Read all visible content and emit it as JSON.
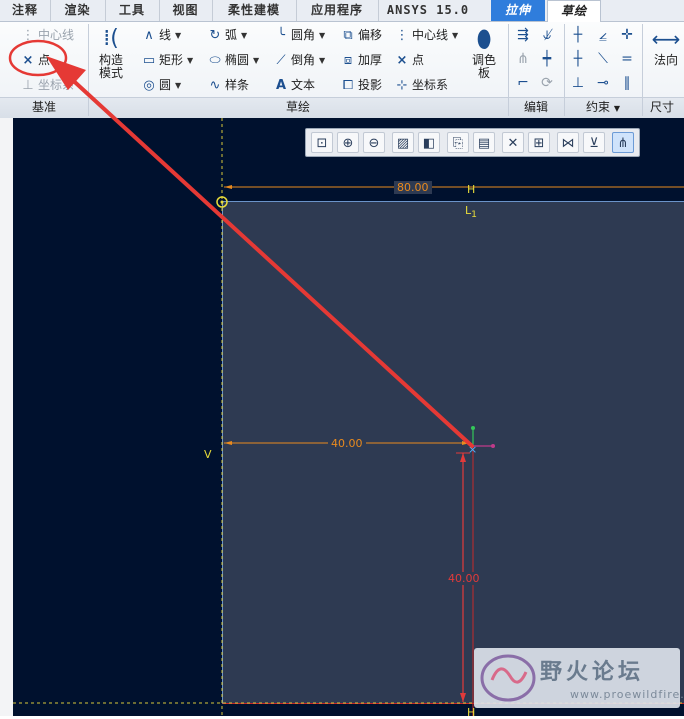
{
  "tabs": [
    {
      "label": "注释"
    },
    {
      "label": "渲染"
    },
    {
      "label": "工具"
    },
    {
      "label": "视图"
    },
    {
      "label": "柔性建模"
    },
    {
      "label": "应用程序"
    },
    {
      "label": "ANSYS 15.0"
    },
    {
      "label": "拉伸"
    },
    {
      "label": "草绘"
    }
  ],
  "ribbon": {
    "datum": {
      "group_label": "基准",
      "centerline": "中心线",
      "point": "点",
      "coord_sys": "坐标系"
    },
    "construction_mode": {
      "line1": "构造",
      "line2": "模式"
    },
    "sketch": {
      "group_label": "草绘",
      "line": "线",
      "rectangle": "矩形",
      "circle": "圆",
      "arc": "弧",
      "ellipse": "椭圆",
      "spline": "样条",
      "fillet": "圆角",
      "chamfer": "倒角",
      "text": "文本",
      "offset": "偏移",
      "thicken": "加厚",
      "project": "投影",
      "centerline": "中心线",
      "point": "点",
      "coord_sys": "坐标系"
    },
    "palette": {
      "line1": "调色",
      "line2": "板"
    },
    "edit": {
      "group_label": "编辑"
    },
    "constrain": {
      "group_label": "约束"
    },
    "dimension": {
      "normal": "法向",
      "group_label": "尺寸"
    }
  },
  "canvas": {
    "dim_top": "80.00",
    "dim_horizontal": "40.00",
    "dim_vertical": "40.00",
    "label_h_top": "H",
    "label_l1": "L",
    "label_l1_sub": "1",
    "label_v": "V",
    "label_h_bottom": "H"
  },
  "watermark": {
    "title": "野火论坛",
    "url": "www.proewildfire.cn"
  },
  "colors": {
    "canvas_bg": "#00112e",
    "sketch_fill": "#2e3a52",
    "dimension": "#e98a1e",
    "constraint_red": "#e23a3a",
    "annotation_red": "#e53935",
    "tab_accent": "#2f7ddc"
  }
}
